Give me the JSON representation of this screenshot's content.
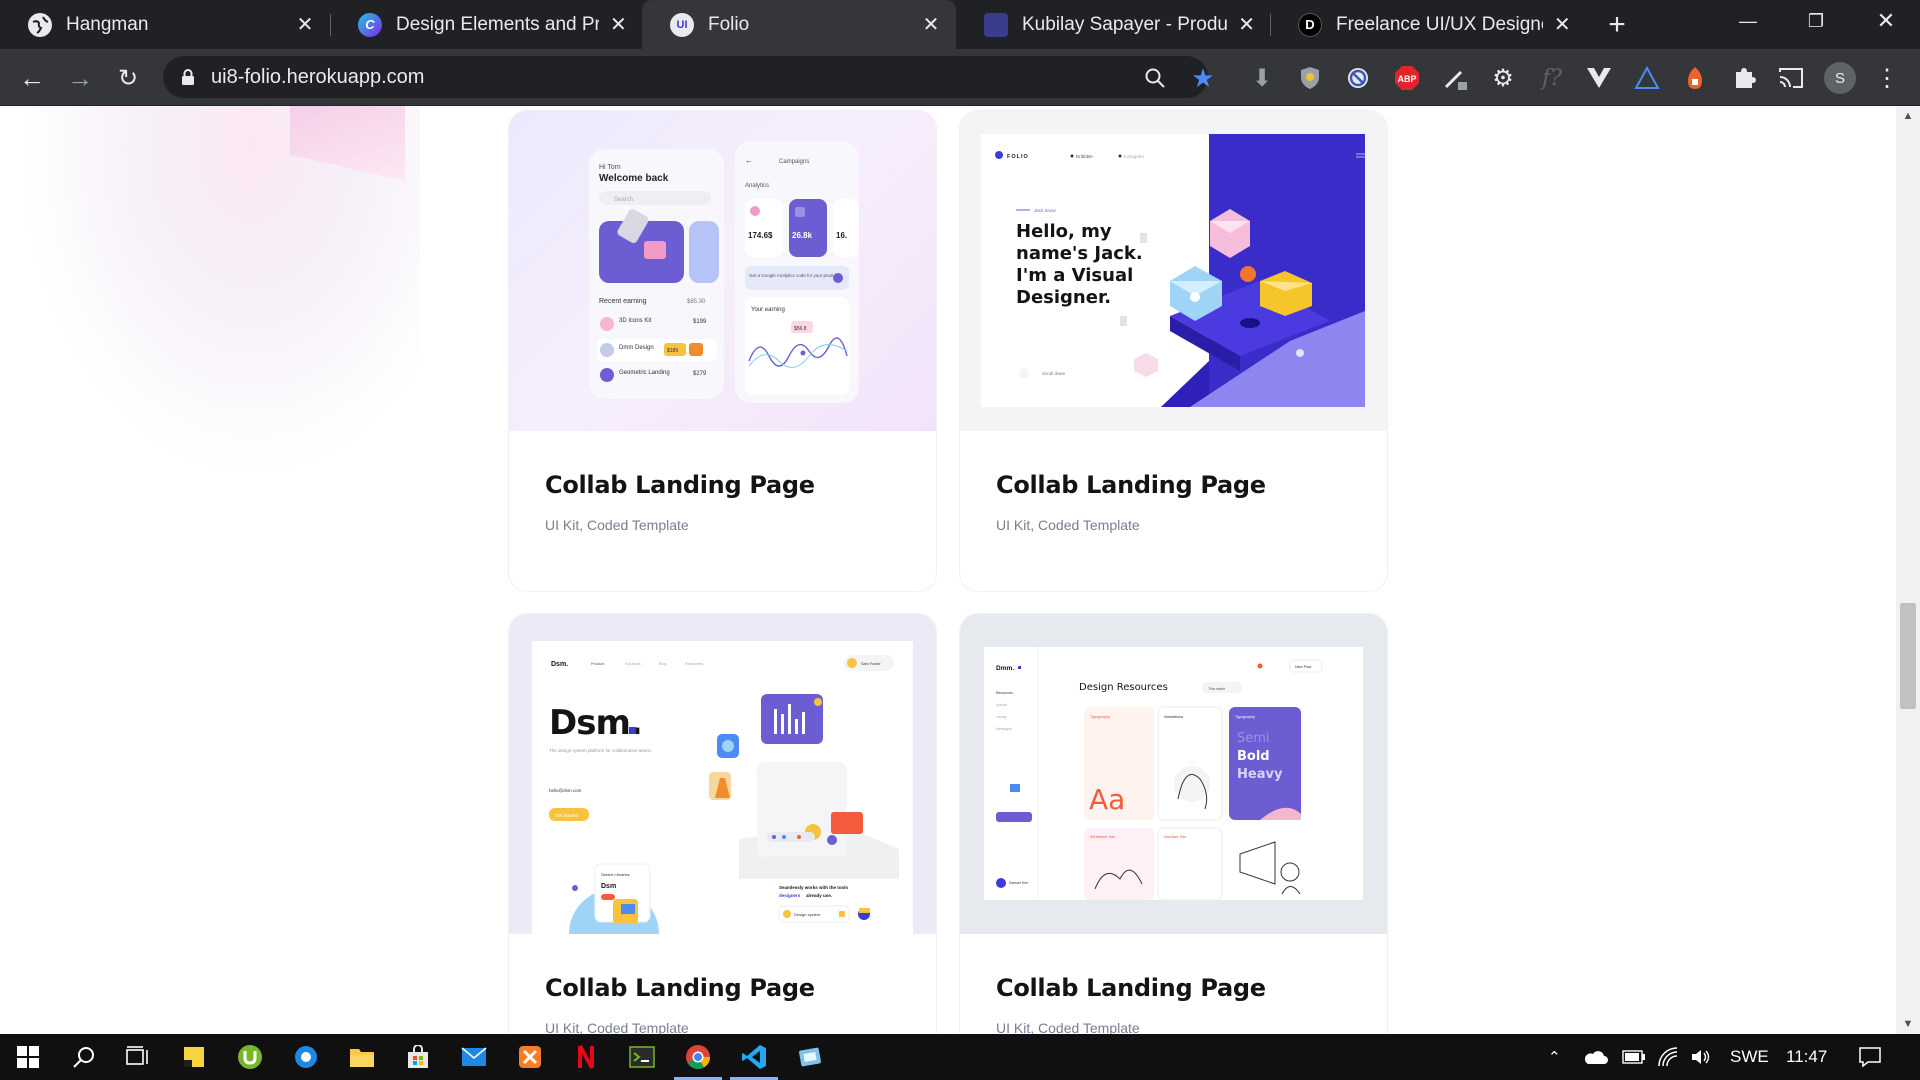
{
  "browser": {
    "tabs": [
      {
        "title": "Hangman",
        "favicon": "globe-icon",
        "active": false
      },
      {
        "title": "Design Elements and Princi",
        "favicon": "canva-icon",
        "active": false
      },
      {
        "title": "Folio",
        "favicon": "ui8-icon",
        "favicon_text": "UI",
        "active": true
      },
      {
        "title": "Kubilay Sapayer - Product D",
        "favicon": "dribbble-icon",
        "active": false
      },
      {
        "title": "Freelance UI/UX Designer -",
        "favicon": "d-icon",
        "favicon_text": "D",
        "active": false
      }
    ],
    "address": "ui8-folio.herokuapp.com",
    "extensions": [
      "zoom-icon",
      "bookmark-star-icon",
      "download-icon",
      "shield-icon",
      "block-icon",
      "abp-icon",
      "pen-icon",
      "gear-icon",
      "formula-icon",
      "vue-icon",
      "triangle-icon",
      "fox-icon",
      "puzzle-icon",
      "cast-icon"
    ],
    "abp_label": "ABP",
    "profile_initial": "S"
  },
  "cards": [
    {
      "title": "Collab Landing Page",
      "subtitle": "UI Kit, Coded Template"
    },
    {
      "title": "Collab Landing Page",
      "subtitle": "UI Kit, Coded Template"
    },
    {
      "title": "Collab Landing Page",
      "subtitle": "UI Kit, Coded Template"
    },
    {
      "title": "Collab Landing Page",
      "subtitle": "UI Kit, Coded Template"
    }
  ],
  "thumb1": {
    "greeting": "Hi Tom",
    "welcome": "Welcome back",
    "search": "Search",
    "recent": "Recent earning",
    "recent_amount": "$85.30",
    "rows": [
      {
        "label": "3D Icons Kit",
        "value": "$199"
      },
      {
        "label": "Dmm Design",
        "value": "$189"
      },
      {
        "label": "Geometric Landing",
        "value": "$279"
      }
    ],
    "campaigns": "Campaigns",
    "analytics": "Analytics",
    "stat1": "174.6$",
    "stat2": "26.8k",
    "stat3": "16.",
    "ga_text": "Get a Google Analytics code for your products",
    "your_earning": "Your earning",
    "earning_badge": "$56.8"
  },
  "thumb2": {
    "logo": "FOLIO",
    "nav1": "Dribbble",
    "nav2": "Instagram",
    "tag": "Jack Snow",
    "headline": [
      "Hello, my",
      "name's Jack.",
      "I'm a Visual",
      "Designer."
    ],
    "scroll": "Scroll down"
  },
  "thumb3": {
    "logo": "Dsm.",
    "nav": [
      "Product",
      "Solutions",
      "Blog",
      "Resources"
    ],
    "user": "Sam Foster",
    "headline": "Dsm.",
    "desc": "The design system platform for collaborative teams.",
    "email": "hello@dsm.com",
    "button": "Get Started",
    "sketch": "Sketch Libraries",
    "card_title": "Dsm",
    "tagline_a": "Seamlessly works with the tools",
    "tagline_b": "designers",
    "tagline_c": "already use.",
    "ds_label": "Design system"
  },
  "thumb4": {
    "logo": "Dmm.",
    "heading": "Design Resources",
    "filter": "This week",
    "new_post": "New Post",
    "menu": [
      "Resources",
      "Upload",
      "Library",
      "Messages"
    ],
    "cards": [
      "Typography",
      "Illustrations",
      "Typography"
    ],
    "aa": "Aa",
    "semi": "Semi",
    "bold": "Bold",
    "heavy": "Heavy",
    "more": [
      "Wireframe Kits",
      "Interface Kits"
    ],
    "user": "Samuel Kim"
  },
  "taskbar": {
    "apps": [
      "windows-start-icon",
      "search-icon",
      "task-view-icon",
      "sticky-notes-icon",
      "utorrent-icon",
      "app-icon",
      "file-explorer-icon",
      "store-icon",
      "mail-icon",
      "xampp-icon",
      "netflix-icon",
      "terminal-icon",
      "chrome-icon",
      "vscode-icon",
      "app2-icon"
    ],
    "language": "SWE",
    "time": "11:47"
  },
  "colors": {
    "chrome_dark": "#202124",
    "chrome_toolbar": "#35363a",
    "title_text": "#141416",
    "subtitle_text": "#777e90",
    "accent_blue": "#3d3ad8",
    "accent_purple": "#6c5dd3"
  }
}
